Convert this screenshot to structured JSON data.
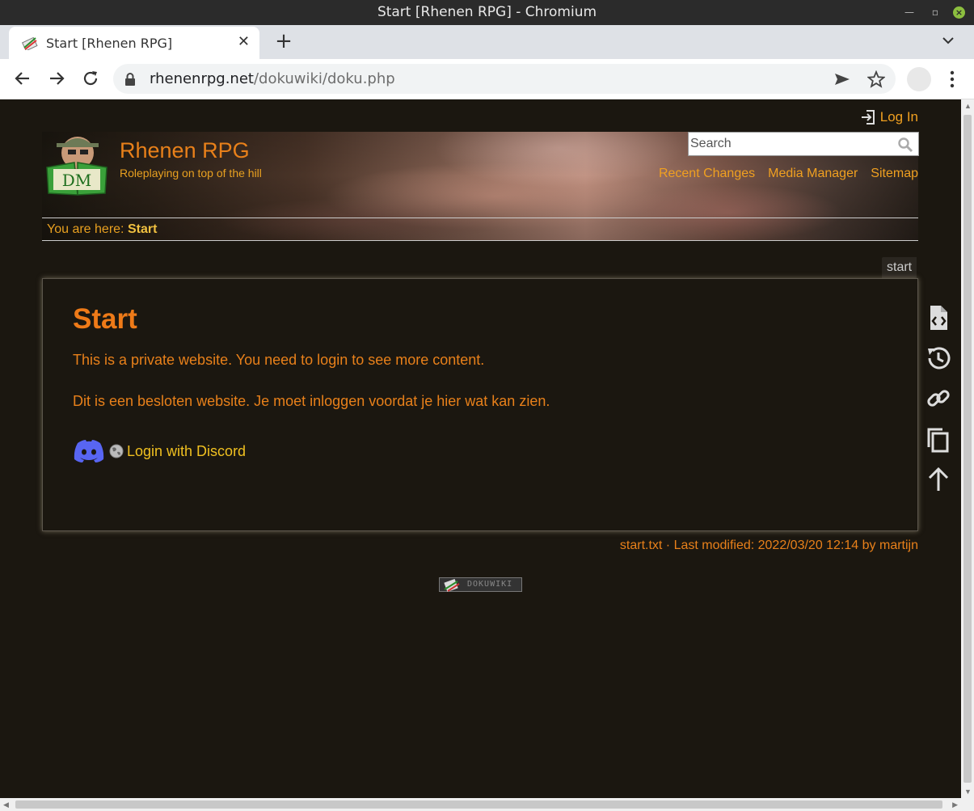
{
  "window": {
    "title": "Start [Rhenen RPG] - Chromium"
  },
  "tabs": [
    {
      "title": "Start [Rhenen RPG]"
    }
  ],
  "omnibox": {
    "host": "rhenenrpg.net",
    "path": "/dokuwiki/doku.php"
  },
  "site": {
    "title": "Rhenen RPG",
    "tagline": "Roleplaying on top of the hill",
    "logo_text": "DM",
    "login_label": "Log In",
    "search_placeholder": "Search",
    "tools": [
      "Recent Changes",
      "Media Manager",
      "Sitemap"
    ],
    "breadcrumb_label": "You are here:",
    "breadcrumb_current": "Start",
    "page_id": "start"
  },
  "content": {
    "heading": "Start",
    "paragraph_en": "This is a private website. You need to login to see more content.",
    "paragraph_nl": "Dit is een besloten website. Je moet inloggen voordat je hier wat kan zien.",
    "discord_link": "Login with Discord"
  },
  "page_tools": [
    "show-pagesource-icon",
    "old-revisions-icon",
    "backlinks-icon",
    "copy-icon",
    "back-to-top-icon"
  ],
  "footer": {
    "docinfo": "start.txt · Last modified: 2022/03/20 12:14 by martijn",
    "badge": "DOKUWIKI"
  },
  "colors": {
    "page_bg": "#1b1710",
    "accent_orange": "#e8801a",
    "link_gold": "#f0a020",
    "discord_blurple": "#5865f2"
  }
}
